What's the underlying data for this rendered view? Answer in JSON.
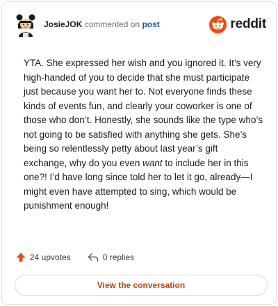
{
  "header": {
    "username": "JosieJOK",
    "action": "commented on",
    "post_link": "post",
    "brand": "reddit"
  },
  "comment": {
    "text_before": "YTA. She expressed her wish and you ignored it. It’s very high-handed of you to decide that she must participate just because you want her to. Not everyone finds these kinds of events fun, and clearly your coworker is one of those who don’t. Honestly, she sounds like the type who’s not going to be satisfied with anything she gets. She’s being so relentlessly petty about last year’s gift exchange, why do you even ",
    "emphasis": "want",
    "text_after": " to include her in this one?! I’d have long since told her to let it go, already—I might even have attempted to sing, which would be punishment enough!"
  },
  "stats": {
    "upvotes": "24 upvotes",
    "replies": "0 replies"
  },
  "cta": {
    "label": "View the conversation"
  },
  "colors": {
    "brand_orange": "#ff4500",
    "link_blue": "#0a5bbd",
    "cta_text": "#d93a00"
  },
  "icons": [
    "avatar-icon",
    "reddit-logo-icon",
    "upvote-arrow-icon",
    "reply-arrow-icon"
  ]
}
